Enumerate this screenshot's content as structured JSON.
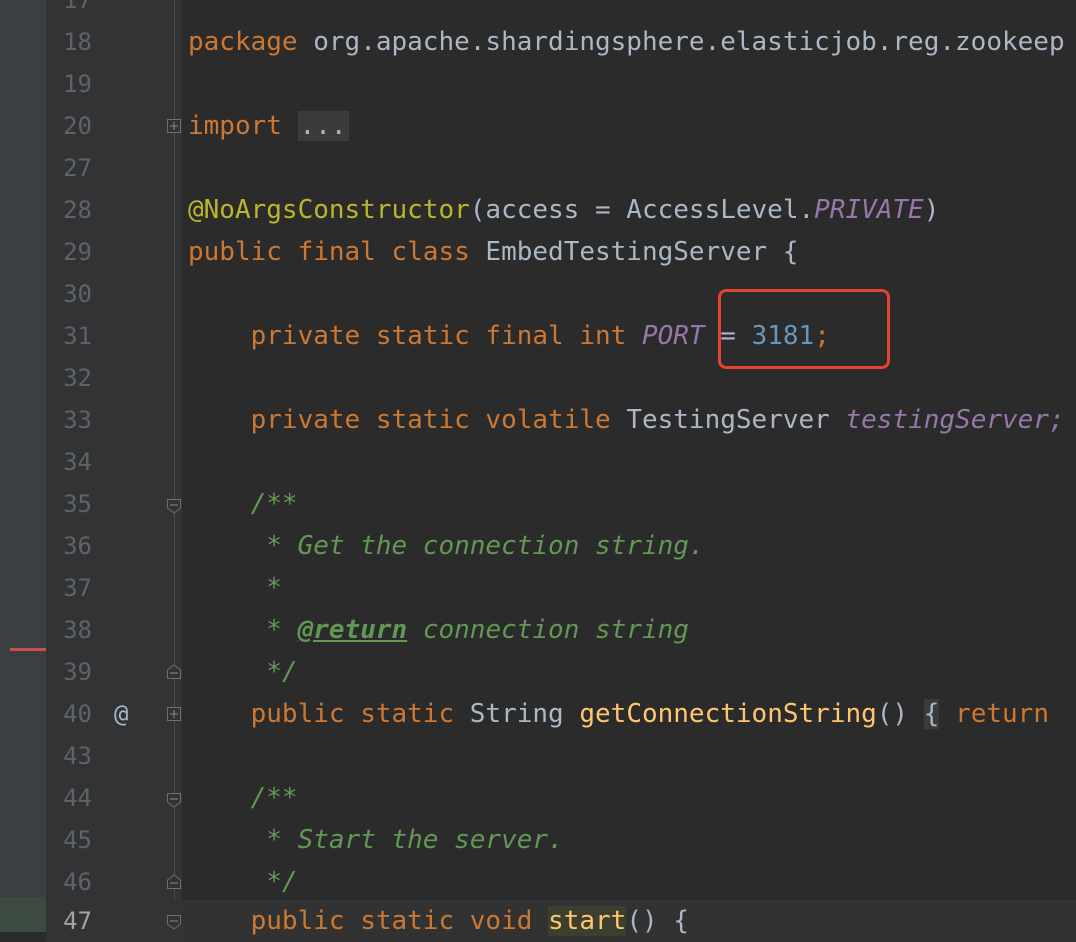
{
  "editor": {
    "lines": [
      {
        "num": "17"
      },
      {
        "num": "18",
        "package_kw": "package",
        "package_name": "org.apache.shardingsphere.elasticjob.reg.zookeep"
      },
      {
        "num": "19"
      },
      {
        "num": "20",
        "import_kw": "import",
        "folded": "..."
      },
      {
        "num": "27"
      },
      {
        "num": "28",
        "annotation": "@NoArgsConstructor",
        "args_open": "(access = AccessLevel.",
        "const": "PRIVATE",
        "args_close": ")"
      },
      {
        "num": "29",
        "mods": "public final class",
        "name": "EmbedTestingServer",
        "brace": "{"
      },
      {
        "num": "30"
      },
      {
        "num": "31",
        "mods": "private static final int",
        "field": "PORT",
        "eq": " = ",
        "value": "3181",
        "semi": ";"
      },
      {
        "num": "32"
      },
      {
        "num": "33",
        "mods": "private static volatile",
        "type": "TestingServer",
        "field": "testingServer;"
      },
      {
        "num": "34"
      },
      {
        "num": "35",
        "doc": "/**"
      },
      {
        "num": "36",
        "doc": " * Get the connection string."
      },
      {
        "num": "37",
        "doc": " *"
      },
      {
        "num": "38",
        "doc_prefix": " * ",
        "doc_tag": "@return",
        "doc_rest": " connection string"
      },
      {
        "num": "39",
        "doc": " */"
      },
      {
        "num": "40",
        "marker": "@",
        "mods": "public static",
        "type": "String",
        "method": "getConnectionString",
        "parens": "()",
        "brace": "{",
        "ret": "return"
      },
      {
        "num": "43"
      },
      {
        "num": "44",
        "doc": "/**"
      },
      {
        "num": "45",
        "doc": " * Start the server."
      },
      {
        "num": "46",
        "doc": " */"
      },
      {
        "num": "47",
        "mods": "public static void",
        "method": "start",
        "parens": "()",
        "brace": "{"
      }
    ]
  },
  "colors": {
    "keyword": "#cc7832",
    "annotation": "#bbb529",
    "constant": "#9876aa",
    "number": "#6897bb",
    "doc_comment": "#629755",
    "method": "#ffc66d",
    "highlight_box": "#e0432f"
  }
}
